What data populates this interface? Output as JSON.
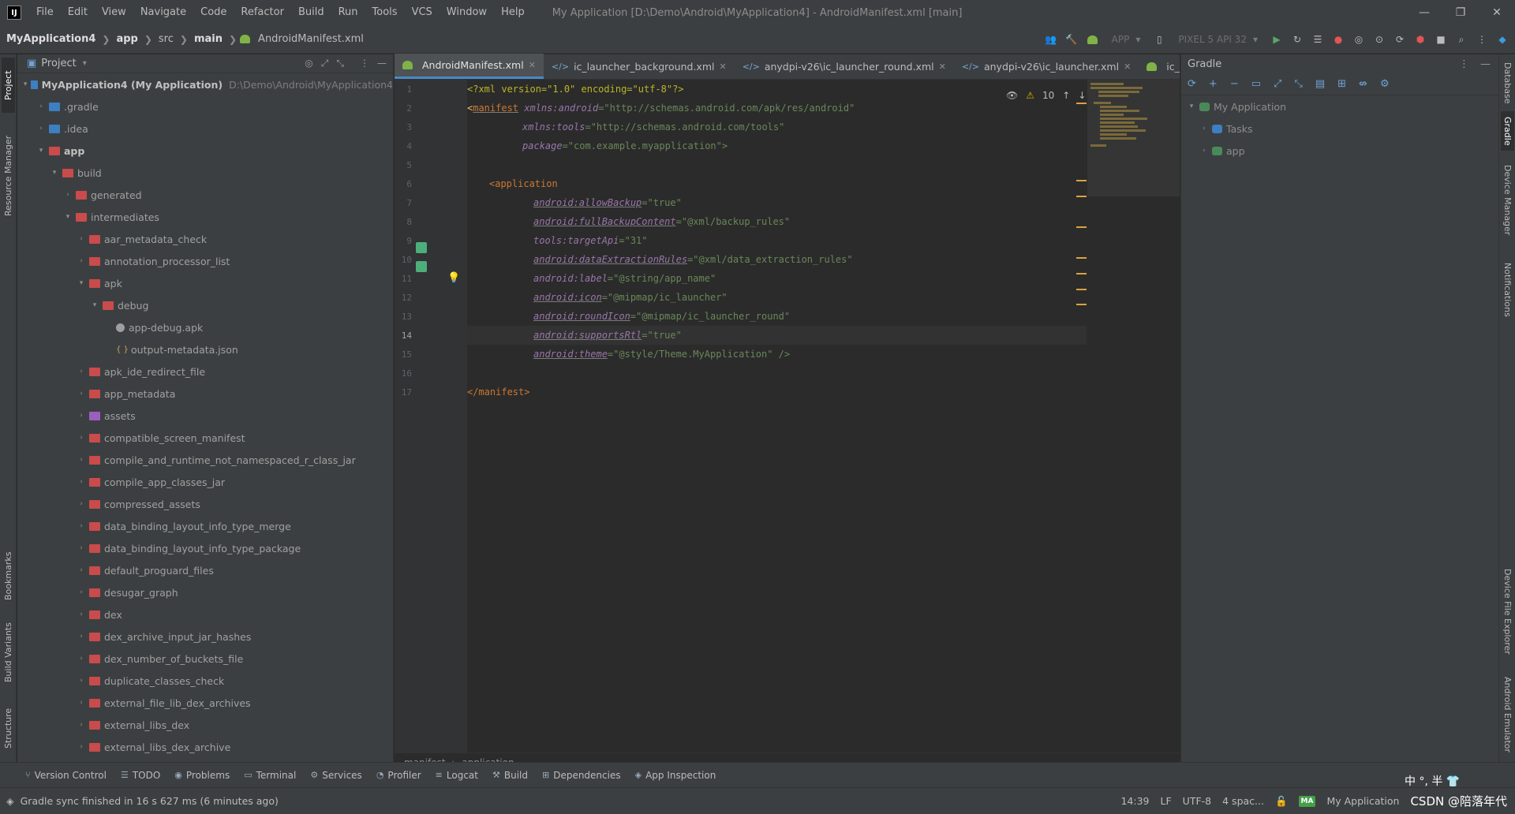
{
  "window": {
    "title": "My Application [D:\\Demo\\Android\\MyApplication4] - AndroidManifest.xml [main]",
    "controls": {
      "minimize": "—",
      "restore": "❐",
      "close": "✕"
    }
  },
  "menu": [
    "File",
    "Edit",
    "View",
    "Navigate",
    "Code",
    "Refactor",
    "Build",
    "Run",
    "Tools",
    "VCS",
    "Window",
    "Help"
  ],
  "logo": "IJ",
  "breadcrumb": {
    "project": "MyApplication4",
    "items": [
      "app",
      "src",
      "main",
      "AndroidManifest.xml"
    ]
  },
  "toolbar": {
    "run_config": "APP",
    "device": "PIXEL 5 API 32"
  },
  "left_stripe": [
    "Project",
    "Resource Manager",
    "Bookmarks",
    "Build Variants",
    "Structure"
  ],
  "right_stripe": [
    "Database",
    "Gradle",
    "Device Manager",
    "Notifications",
    "Device File Explorer",
    "Android Emulator"
  ],
  "project_panel": {
    "title": "Project",
    "tree": [
      {
        "depth": 0,
        "arrow": "▾",
        "icon": "blue",
        "label": "MyApplication4 (My Application)",
        "path": "D:\\Demo\\Android\\MyApplication4",
        "bold": true
      },
      {
        "depth": 1,
        "arrow": "›",
        "icon": "blue",
        "label": ".gradle"
      },
      {
        "depth": 1,
        "arrow": "›",
        "icon": "blue",
        "label": ".idea"
      },
      {
        "depth": 1,
        "arrow": "▾",
        "icon": "red",
        "label": "app",
        "bold": true
      },
      {
        "depth": 2,
        "arrow": "▾",
        "icon": "red",
        "label": "build"
      },
      {
        "depth": 3,
        "arrow": "›",
        "icon": "red",
        "label": "generated"
      },
      {
        "depth": 3,
        "arrow": "▾",
        "icon": "red",
        "label": "intermediates"
      },
      {
        "depth": 4,
        "arrow": "›",
        "icon": "red",
        "label": "aar_metadata_check"
      },
      {
        "depth": 4,
        "arrow": "›",
        "icon": "red",
        "label": "annotation_processor_list"
      },
      {
        "depth": 4,
        "arrow": "▾",
        "icon": "red",
        "label": "apk"
      },
      {
        "depth": 5,
        "arrow": "▾",
        "icon": "red",
        "label": "debug"
      },
      {
        "depth": 6,
        "arrow": "",
        "icon": "apk",
        "label": "app-debug.apk"
      },
      {
        "depth": 6,
        "arrow": "",
        "icon": "json",
        "label": "output-metadata.json"
      },
      {
        "depth": 4,
        "arrow": "›",
        "icon": "red",
        "label": "apk_ide_redirect_file"
      },
      {
        "depth": 4,
        "arrow": "›",
        "icon": "red",
        "label": "app_metadata"
      },
      {
        "depth": 4,
        "arrow": "›",
        "icon": "purple",
        "label": "assets"
      },
      {
        "depth": 4,
        "arrow": "›",
        "icon": "red",
        "label": "compatible_screen_manifest"
      },
      {
        "depth": 4,
        "arrow": "›",
        "icon": "red",
        "label": "compile_and_runtime_not_namespaced_r_class_jar"
      },
      {
        "depth": 4,
        "arrow": "›",
        "icon": "red",
        "label": "compile_app_classes_jar"
      },
      {
        "depth": 4,
        "arrow": "›",
        "icon": "red",
        "label": "compressed_assets"
      },
      {
        "depth": 4,
        "arrow": "›",
        "icon": "red",
        "label": "data_binding_layout_info_type_merge"
      },
      {
        "depth": 4,
        "arrow": "›",
        "icon": "red",
        "label": "data_binding_layout_info_type_package"
      },
      {
        "depth": 4,
        "arrow": "›",
        "icon": "red",
        "label": "default_proguard_files"
      },
      {
        "depth": 4,
        "arrow": "›",
        "icon": "red",
        "label": "desugar_graph"
      },
      {
        "depth": 4,
        "arrow": "›",
        "icon": "red",
        "label": "dex"
      },
      {
        "depth": 4,
        "arrow": "›",
        "icon": "red",
        "label": "dex_archive_input_jar_hashes"
      },
      {
        "depth": 4,
        "arrow": "›",
        "icon": "red",
        "label": "dex_number_of_buckets_file"
      },
      {
        "depth": 4,
        "arrow": "›",
        "icon": "red",
        "label": "duplicate_classes_check"
      },
      {
        "depth": 4,
        "arrow": "›",
        "icon": "red",
        "label": "external_file_lib_dex_archives"
      },
      {
        "depth": 4,
        "arrow": "›",
        "icon": "red",
        "label": "external_libs_dex"
      },
      {
        "depth": 4,
        "arrow": "›",
        "icon": "red",
        "label": "external_libs_dex_archive"
      }
    ]
  },
  "editor": {
    "tabs": [
      {
        "label": "AndroidManifest.xml",
        "active": true
      },
      {
        "label": "ic_launcher_background.xml",
        "active": false
      },
      {
        "label": "anydpi-v26\\ic_launcher_round.xml",
        "active": false
      },
      {
        "label": "anydpi-v26\\ic_launcher.xml",
        "active": false
      },
      {
        "label": "ic_launcher.",
        "active": false
      }
    ],
    "warnings": "10",
    "current_line": 14,
    "lines": [
      "1",
      "2",
      "3",
      "4",
      "5",
      "6",
      "7",
      "8",
      "9",
      "10",
      "11",
      "12",
      "13",
      "14",
      "15",
      "16",
      "17"
    ],
    "code": {
      "l1_pi": "<?xml version=\"1.0\" encoding=\"utf-8\"?>",
      "l2_tag": "<",
      "l2_name": "manifest",
      "l2_ns": " xmlns:",
      "l2_attr": "android",
      "l2_val": "=\"http://schemas.android.com/apk/res/android\"",
      "l3_ns": "xmlns:",
      "l3_attr": "tools",
      "l3_val": "=\"http://schemas.android.com/tools\"",
      "l4_attr": "package",
      "l4_val": "=\"com.example.myapplication\">",
      "l6": "<application",
      "l7_attr": "android:allowBackup",
      "l7_val": "=\"true\"",
      "l8_attr": "android:fullBackupContent",
      "l8_val": "=\"@xml/backup_rules\"",
      "l9_attr": "tools:targetApi",
      "l9_val": "=\"31\"",
      "l10_attr": "android:dataExtractionRules",
      "l10_val": "=\"@xml/data_extraction_rules\"",
      "l11_attr": "android:label",
      "l11_val": "=\"@string/app_name\"",
      "l12_attr": "android:icon",
      "l12_val": "=\"@mipmap/ic_launcher\"",
      "l13_attr": "android:roundIcon",
      "l13_val": "=\"@mipmap/ic_launcher_round\"",
      "l14_attr": "android:supportsRtl",
      "l14_val": "=\"true\"",
      "l15_attr": "android:theme",
      "l15_val": "=\"@style/Theme.MyApplication\" />",
      "l17": "</manifest>"
    },
    "breadcrumb": [
      "manifest",
      "application"
    ]
  },
  "gradle_panel": {
    "title": "Gradle",
    "tree": [
      {
        "depth": 0,
        "arrow": "▾",
        "label": "My Application"
      },
      {
        "depth": 1,
        "arrow": "›",
        "label": "Tasks"
      },
      {
        "depth": 1,
        "arrow": "›",
        "label": "app"
      }
    ]
  },
  "bottom_tools": [
    "Version Control",
    "TODO",
    "Problems",
    "Terminal",
    "Services",
    "Profiler",
    "Logcat",
    "Build",
    "Dependencies",
    "App Inspection"
  ],
  "status": {
    "message": "Gradle sync finished in 16 s 627 ms (6 minutes ago)",
    "position": "14:39",
    "line_sep": "LF",
    "encoding": "UTF-8",
    "indent": "4 spac...",
    "module_badge": "MA",
    "module": "My Application",
    "watermark": "CSDN @陪落年代",
    "ime": "中 °, 半 👕"
  }
}
